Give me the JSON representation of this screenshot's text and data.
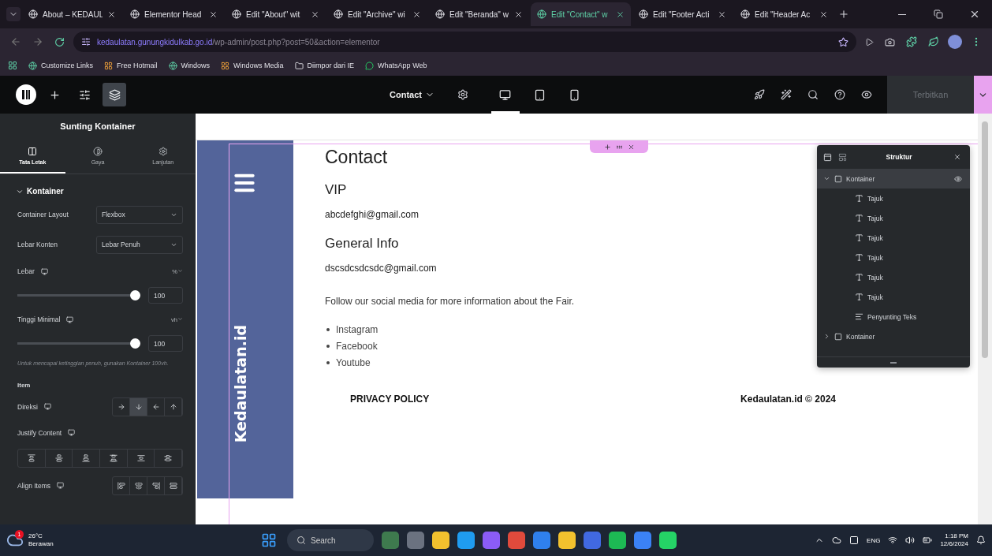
{
  "browser": {
    "tabs": [
      {
        "title": "About – KEDAUL",
        "selected": false
      },
      {
        "title": "Elementor Head",
        "selected": false
      },
      {
        "title": "Edit \"About\" wit",
        "selected": false
      },
      {
        "title": "Edit \"Archive\" wi",
        "selected": false
      },
      {
        "title": "Edit \"Beranda\" w",
        "selected": false
      },
      {
        "title": "Edit \"Contact\" w",
        "selected": true
      },
      {
        "title": "Edit \"Footer Acti",
        "selected": false
      },
      {
        "title": "Edit \"Header Ac",
        "selected": false
      }
    ],
    "url": {
      "domain": "kedaulatan.gunungkidulkab.go.id",
      "path": "/wp-admin/post.php?post=50&action=elementor"
    },
    "bookmarks": [
      {
        "label": "Customize Links",
        "kind": "globe"
      },
      {
        "label": "Free Hotmail",
        "kind": "windows"
      },
      {
        "label": "Windows",
        "kind": "globe"
      },
      {
        "label": "Windows Media",
        "kind": "windows"
      },
      {
        "label": "Diimpor dari IE",
        "kind": "folder"
      },
      {
        "label": "WhatsApp Web",
        "kind": "whatsapp"
      }
    ]
  },
  "editor_bar": {
    "tools": [
      {
        "selected": false
      },
      {
        "selected": false
      },
      {
        "selected": true
      }
    ],
    "page": "Contact",
    "devices": [
      {
        "selected": true
      },
      {
        "selected": false
      },
      {
        "selected": false
      }
    ],
    "publish": {
      "label": "Terbitkan",
      "disabled": true
    }
  },
  "panel": {
    "title": "Sunting Kontainer",
    "tabs": [
      {
        "label": "Tata Letak",
        "selected": true
      },
      {
        "label": "Gaya",
        "selected": false
      },
      {
        "label": "Lanjutan",
        "selected": false
      }
    ],
    "section": {
      "label": "Kontainer",
      "expanded": true
    },
    "controls": [
      {
        "kind": "select",
        "label": "Container Layout",
        "value": "Flexbox"
      },
      {
        "kind": "select",
        "label": "Lebar Konten",
        "value": "Lebar Penuh"
      },
      {
        "kind": "slider",
        "label": "Lebar",
        "unit": "%",
        "value": "100",
        "level": 1
      },
      {
        "kind": "slider",
        "label": "Tinggi Minimal",
        "unit": "vh",
        "value": "100",
        "level": 1
      },
      {
        "kind": "note",
        "text": "Untuk mencapai ketinggian penuh, gunakan Kontainer 100vh."
      },
      {
        "kind": "heading",
        "label": "Item"
      },
      {
        "kind": "choices",
        "label": "Direksi",
        "options": [
          {
            "selected": false
          },
          {
            "selected": true
          },
          {
            "selected": false
          },
          {
            "selected": false
          }
        ]
      },
      {
        "kind": "wide_choices",
        "label": "Justify Content",
        "options": [
          {
            "selected": false
          },
          {
            "selected": false
          },
          {
            "selected": false
          },
          {
            "selected": false
          },
          {
            "selected": false
          },
          {
            "selected": false
          }
        ]
      },
      {
        "kind": "choices",
        "label": "Align Items",
        "options": [
          {
            "selected": false
          },
          {
            "selected": false
          },
          {
            "selected": false
          },
          {
            "selected": false
          }
        ]
      }
    ]
  },
  "page": {
    "sidebar_title": "Kedaulatan.id",
    "title": "Contact",
    "blocks": [
      {
        "kind": "heading",
        "text": "VIP"
      },
      {
        "kind": "text",
        "text": "abcdefghi@gmail.com"
      },
      {
        "kind": "heading",
        "text": "General Info"
      },
      {
        "kind": "text",
        "text": "dscsdcsdcsdc@gmail.com"
      },
      {
        "kind": "paragraph",
        "text": "Follow our social media for more information about the Fair."
      },
      {
        "kind": "list",
        "items": [
          "Instagram",
          "Facebook",
          "Youtube"
        ]
      }
    ],
    "footer": {
      "left": "PRIVACY POLICY",
      "right": "Kedaulatan.id © 2024"
    }
  },
  "structure": {
    "title": "Struktur",
    "tree": [
      {
        "label": "Kontainer",
        "kind": "container",
        "expanded": true,
        "selected": true,
        "children": [
          {
            "label": "Tajuk",
            "kind": "heading",
            "selected": false
          },
          {
            "label": "Tajuk",
            "kind": "heading",
            "selected": false
          },
          {
            "label": "Tajuk",
            "kind": "heading",
            "selected": false
          },
          {
            "label": "Tajuk",
            "kind": "heading",
            "selected": false
          },
          {
            "label": "Tajuk",
            "kind": "heading",
            "selected": false
          },
          {
            "label": "Tajuk",
            "kind": "heading",
            "selected": false
          },
          {
            "label": "Penyunting Teks",
            "kind": "text",
            "selected": false
          }
        ]
      },
      {
        "label": "Kontainer",
        "kind": "container",
        "expanded": false,
        "selected": false
      }
    ]
  },
  "taskbar": {
    "weather": {
      "temp": "26°C",
      "condition": "Berawan",
      "badge": "1"
    },
    "search": {
      "placeholder": "Search"
    },
    "language": "ENG",
    "time": "1:18 PM",
    "date": "12/6/2024"
  }
}
